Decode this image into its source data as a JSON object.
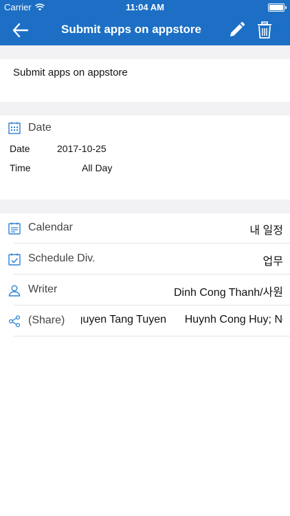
{
  "status": {
    "carrier": "Carrier",
    "time": "11:04 AM"
  },
  "nav": {
    "title": "Submit apps on appstore"
  },
  "subject": "Submit apps on appstore",
  "date_section": {
    "header": "Date",
    "date_label": "Date",
    "date_value": "2017-10-25",
    "time_label": "Time",
    "time_value": "All Day"
  },
  "details": {
    "calendar": {
      "label": "Calendar",
      "value": "내 일정"
    },
    "schedule_div": {
      "label": "Schedule Div.",
      "value": "업무"
    },
    "writer": {
      "label": "Writer",
      "value": "Dinh Cong Thanh/사원"
    },
    "share": {
      "label": "(Share)",
      "value": "Nguyen Tang Tuyen      Huynh Cong Huy; Nguyen"
    }
  },
  "colors": {
    "brand": "#1c6fc4",
    "icon": "#2a7fd4",
    "separator": "#f2f2f4"
  },
  "icons": {
    "back": "arrow-left-icon",
    "edit": "pencil-icon",
    "delete": "trash-icon",
    "calendar": "calendar-icon",
    "schedule": "calendar-check-icon",
    "writer": "person-icon",
    "share": "share-icon"
  }
}
